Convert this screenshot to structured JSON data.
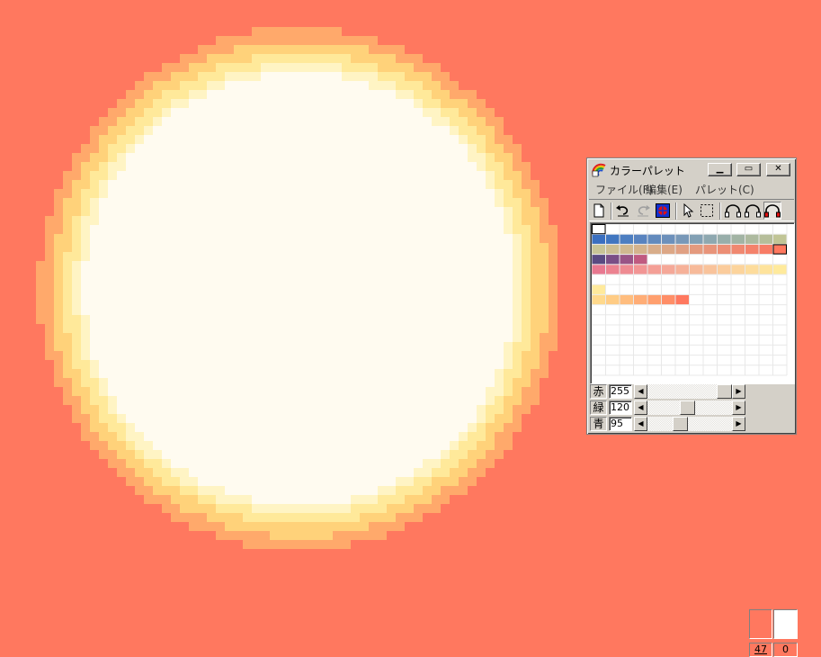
{
  "canvas": {
    "background": "#ff785f",
    "glow_colors": [
      "#ff785f",
      "#ffa96b",
      "#ffd27a",
      "#ffe99a",
      "#fff4c4",
      "#fffbf0"
    ]
  },
  "window": {
    "title": "カラーパレット",
    "minimize_glyph": "▁",
    "maximize_glyph": "▭",
    "close_glyph": "✕"
  },
  "menu": {
    "file": "ファイル(F)",
    "edit": "編集(E)",
    "palette": "パレット(C)"
  },
  "toolbar": {
    "icons": [
      "new-icon",
      "undo-icon",
      "redo-icon",
      "swap-color-icon",
      "pointer-icon",
      "select-rect-icon",
      "dropper-a-icon",
      "dropper-b-icon",
      "dropper-c-icon"
    ]
  },
  "palette": {
    "rows": [
      [
        "#ffffff"
      ],
      [
        "#3a6fc0",
        "#4076c0",
        "#4c7ec1",
        "#5883bf",
        "#628abd",
        "#6c90bb",
        "#7898b8",
        "#82a0b4",
        "#8ea8b0",
        "#98aeaa",
        "#a2b4a4",
        "#adba9f",
        "#b6be9a",
        "#c1c596"
      ],
      [
        "#c8c497",
        "#ccbe94",
        "#d0b890",
        "#d4b38d",
        "#d8ad8a",
        "#dca786",
        "#e0a083",
        "#e49a7e",
        "#e8947a",
        "#ec8e75",
        "#f08870",
        "#f4826b",
        "#f87c66",
        "#ff785f"
      ],
      [
        "#5a4a82",
        "#7a4e86",
        "#9a5486",
        "#c05a80"
      ],
      [
        "#e87890",
        "#ec8290",
        "#ef8b92",
        "#f29594",
        "#f49f96",
        "#f5a898",
        "#f6b199",
        "#f7ba9a",
        "#f9c39b",
        "#fbcc9c",
        "#fcd49c",
        "#fddc9c",
        "#fee39c",
        "#ffea9c"
      ],
      [],
      [
        "#ffea9c"
      ],
      [
        "#ffd98c",
        "#ffcc85",
        "#ffbd7e",
        "#ffad76",
        "#ff9f6e",
        "#ff8e67",
        "#ff785f"
      ]
    ],
    "selected_color": "#ff785f"
  },
  "sliders": {
    "red": {
      "label": "赤",
      "value": "255",
      "fraction": 1.0
    },
    "green": {
      "label": "緑",
      "value": "120",
      "fraction": 0.47
    },
    "blue": {
      "label": "青",
      "value": "95",
      "fraction": 0.37
    }
  },
  "current_color": "#ff785f",
  "previous_color": "#ffffff",
  "color_index": "47",
  "color_count": "0"
}
